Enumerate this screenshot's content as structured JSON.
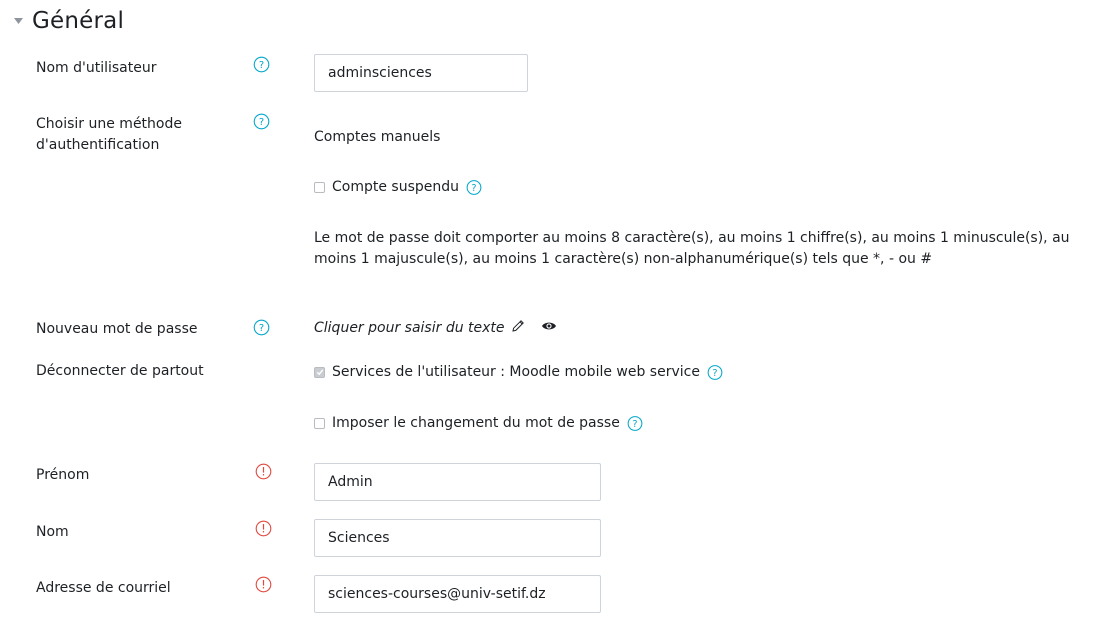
{
  "section": {
    "title": "Général"
  },
  "fields": {
    "username": {
      "label": "Nom d'utilisateur",
      "value": "adminsciences"
    },
    "auth": {
      "label_line1": "Choisir une méthode",
      "label_line2": "d'authentification",
      "value": "Comptes manuels"
    },
    "suspended": {
      "label": "Compte suspendu",
      "checked": false
    },
    "password_policy": "Le mot de passe doit comporter au moins 8 caractère(s), au moins 1 chiffre(s), au moins 1 minuscule(s), au moins 1 majuscule(s), au moins 1 caractère(s) non-alphanumérique(s) tels que *, - ou #",
    "new_password": {
      "label": "Nouveau mot de passe",
      "placeholder": "Cliquer pour saisir du texte"
    },
    "logout": {
      "label": "Déconnecter de partout",
      "service_label": "Services de l'utilisateur : Moodle mobile web service",
      "checked": true
    },
    "force_change": {
      "label": "Imposer le changement du mot de passe",
      "checked": false
    },
    "firstname": {
      "label": "Prénom",
      "value": "Admin"
    },
    "lastname": {
      "label": "Nom",
      "value": "Sciences"
    },
    "email": {
      "label": "Adresse de courriel",
      "value": "sciences-courses@univ-setif.dz"
    }
  },
  "colors": {
    "help_icon": "#00a6c9",
    "required_icon": "#e0473f",
    "text": "#1d2125",
    "border": "#ced4da"
  },
  "icons": {
    "collapse": "caret-down-icon",
    "help": "question-circle-icon",
    "required": "exclamation-circle-icon",
    "edit": "pencil-icon",
    "reveal": "eye-icon"
  }
}
